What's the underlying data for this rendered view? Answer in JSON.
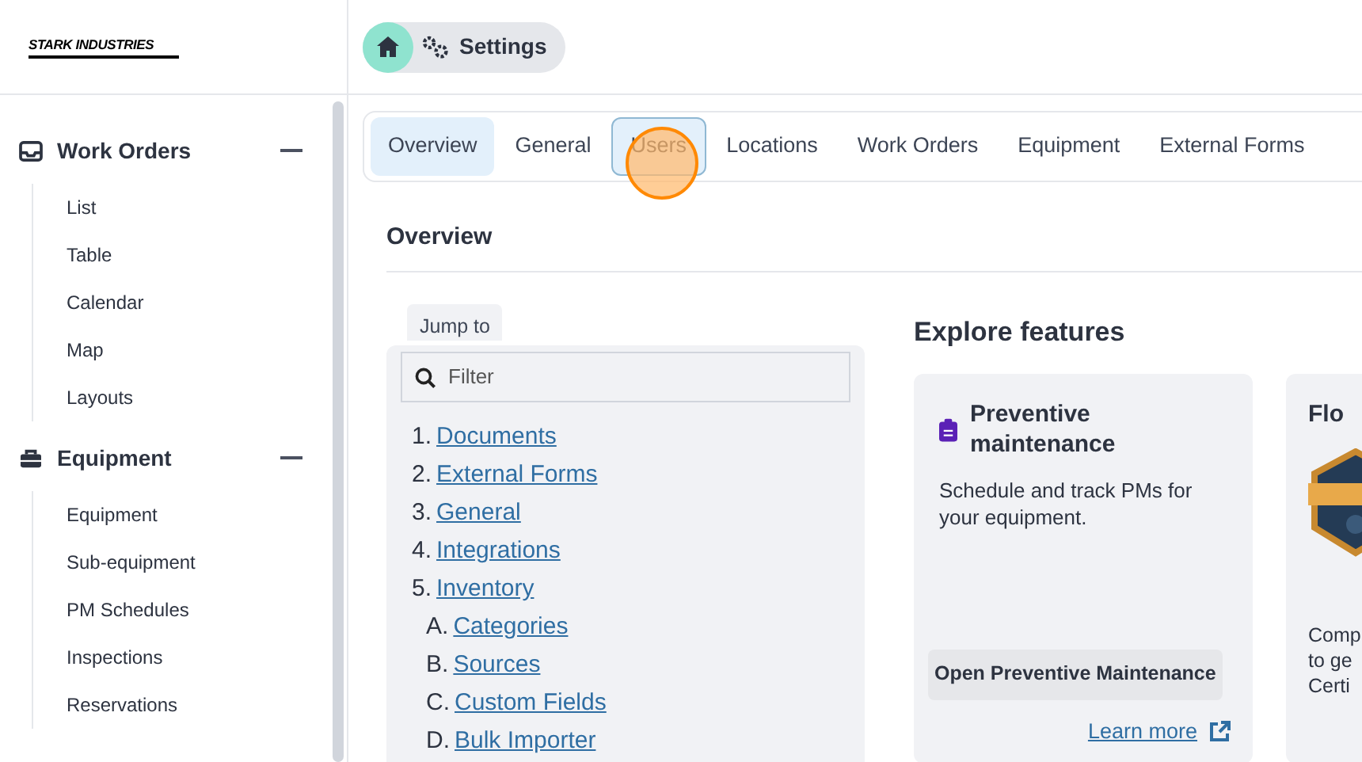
{
  "logo": {
    "text": "STARK INDUSTRIES"
  },
  "breadcrumb": {
    "items": [
      {
        "kind": "home"
      },
      {
        "kind": "settings",
        "label": "Settings"
      }
    ]
  },
  "sidebar": {
    "sections": [
      {
        "title": "Work Orders",
        "expanded": true,
        "items": [
          "List",
          "Table",
          "Calendar",
          "Map",
          "Layouts"
        ]
      },
      {
        "title": "Equipment",
        "expanded": true,
        "items": [
          "Equipment",
          "Sub-equipment",
          "PM Schedules",
          "Inspections",
          "Reservations"
        ]
      }
    ]
  },
  "tabs": [
    {
      "label": "Overview",
      "selected": true,
      "hovered": false
    },
    {
      "label": "General",
      "selected": false,
      "hovered": false
    },
    {
      "label": "Users",
      "selected": false,
      "hovered": true
    },
    {
      "label": "Locations",
      "selected": false,
      "hovered": false
    },
    {
      "label": "Work Orders",
      "selected": false,
      "hovered": false
    },
    {
      "label": "Equipment",
      "selected": false,
      "hovered": false
    },
    {
      "label": "External Forms",
      "selected": false,
      "hovered": false
    }
  ],
  "section_title": "Overview",
  "jump_to": {
    "label": "Jump to",
    "filter": {
      "placeholder": "Filter"
    },
    "items": [
      {
        "marker": "1.",
        "label": "Documents"
      },
      {
        "marker": "2.",
        "label": "External Forms"
      },
      {
        "marker": "3.",
        "label": "General"
      },
      {
        "marker": "4.",
        "label": "Integrations"
      },
      {
        "marker": "5.",
        "label": "Inventory",
        "children": [
          {
            "marker": "A.",
            "label": "Categories"
          },
          {
            "marker": "B.",
            "label": "Sources"
          },
          {
            "marker": "C.",
            "label": "Custom Fields"
          },
          {
            "marker": "D.",
            "label": "Bulk Importer"
          }
        ]
      }
    ]
  },
  "explore": {
    "title": "Explore features",
    "cards": [
      {
        "kind": "feature",
        "title": "Preventive maintenance",
        "description": "Schedule and track PMs for your equipment.",
        "button": "Open Preventive Maintenance",
        "link": "Learn more"
      },
      {
        "kind": "partial",
        "title": "Flo",
        "description_lines": [
          "Comp",
          "to ge",
          "Certi"
        ]
      }
    ]
  }
}
